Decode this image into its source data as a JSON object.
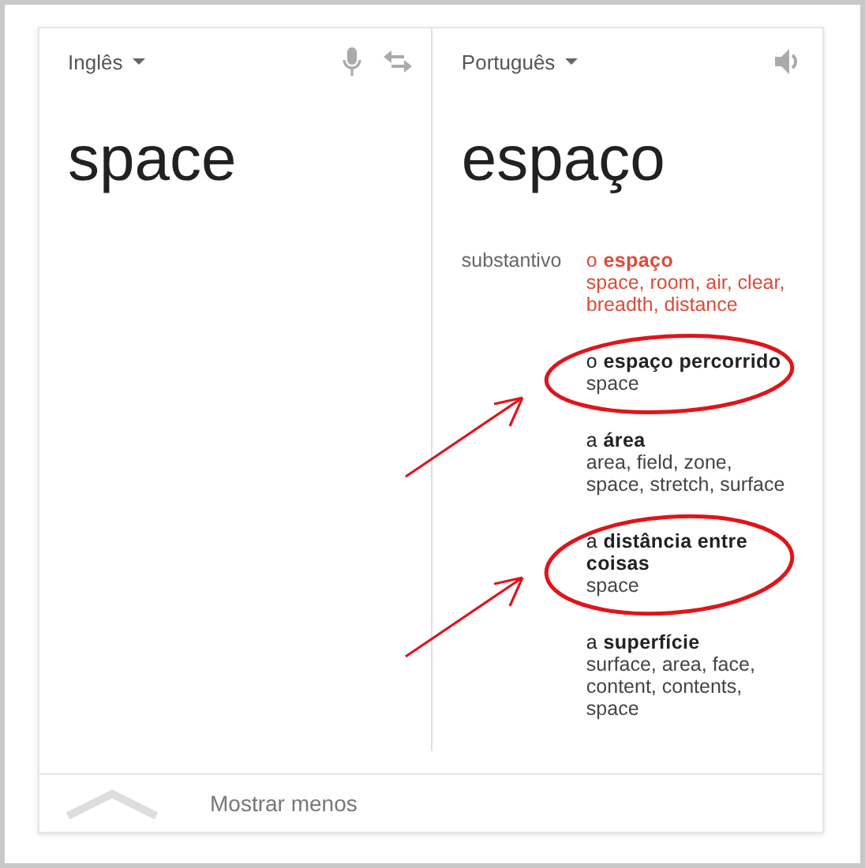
{
  "source": {
    "language": "Inglês",
    "text": "space"
  },
  "target": {
    "language": "Português",
    "text": "espaço"
  },
  "dictionary": {
    "part_of_speech": "substantivo",
    "entries": [
      {
        "term": "o **espaço**",
        "translations": "space, room, air, clear, breadth, distance",
        "highlighted": true,
        "circled": false
      },
      {
        "term": "o **espaço percorrido**",
        "translations": "space",
        "highlighted": false,
        "circled": true
      },
      {
        "term": "a **área**",
        "translations": "area, field, zone, space, stretch, surface",
        "highlighted": false,
        "circled": false
      },
      {
        "term": "a **distância entre coisas**",
        "translations": "space",
        "highlighted": false,
        "circled": true
      },
      {
        "term": "a **superfície**",
        "translations": "surface, area, face, content, contents, space",
        "highlighted": false,
        "circled": false
      }
    ]
  },
  "footer": {
    "label": "Mostrar menos"
  }
}
